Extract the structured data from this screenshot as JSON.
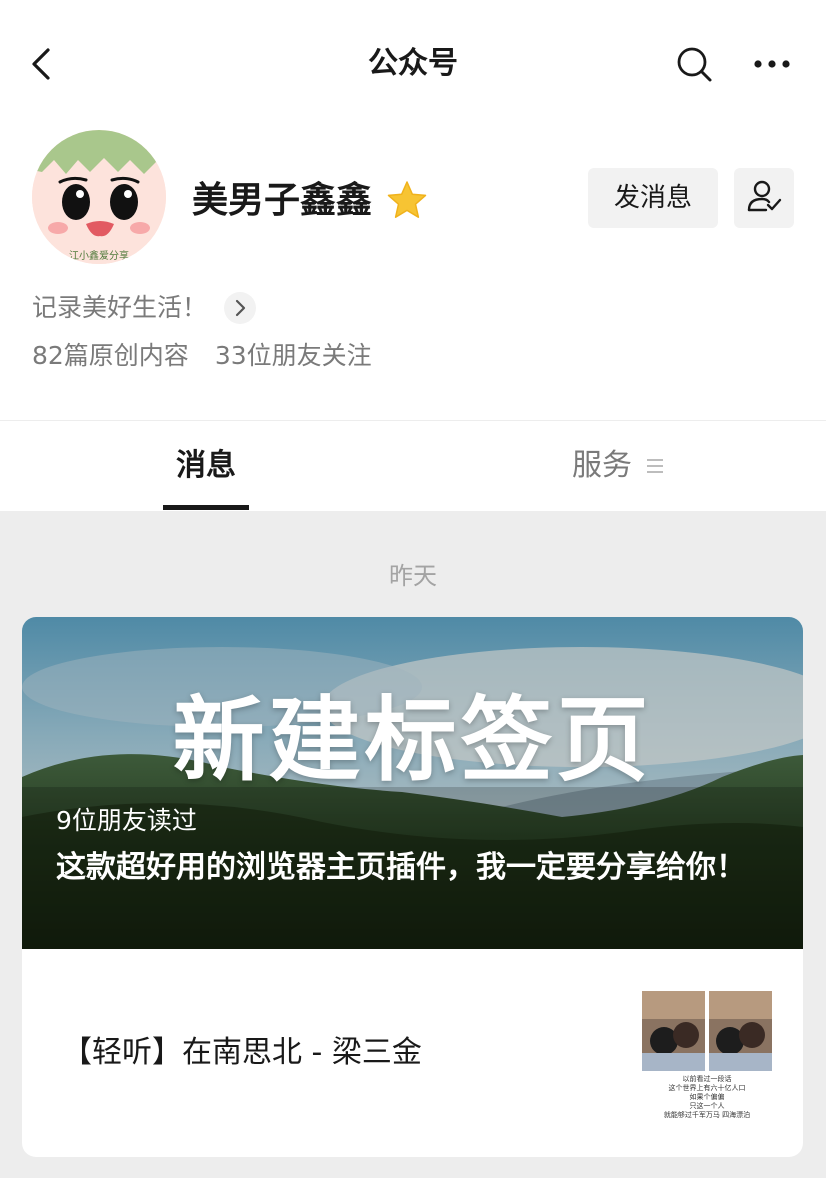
{
  "nav": {
    "title": "公众号",
    "back_icon": "chevron-left-icon",
    "search_icon": "search-icon",
    "more_icon": "more-dots-icon"
  },
  "profile": {
    "avatar_caption": "江小鑫爱分享",
    "name": "美男子鑫鑫",
    "star_color": "#f7c433",
    "send_message_label": "发消息",
    "follow_icon": "user-check-icon",
    "bio": "记录美好生活！",
    "stats": {
      "original_content": "82篇原创内容",
      "friends_following": "33位朋友关注"
    }
  },
  "tabs": [
    {
      "label": "消息",
      "active": true
    },
    {
      "label": "服务",
      "active": false,
      "icon": "menu-icon"
    }
  ],
  "feed": {
    "date_label": "昨天",
    "main_article": {
      "cover_headline": "新建标签页",
      "read_count": "9位朋友读过",
      "title": "这款超好用的浏览器主页插件，我一定要分享给你！"
    },
    "sub_article": {
      "title": "【轻听】在南思北 - 梁三金",
      "thumbnail_caption": [
        "以前看过一段话",
        "这个世界上有六十亿人口",
        "如果个偏偏",
        "只这一个人",
        "就能够过千军万马 四海漂泊"
      ]
    }
  },
  "colors": {
    "page_bg": "#ededed",
    "text_primary": "#191919",
    "text_secondary": "#7a7a7a"
  }
}
